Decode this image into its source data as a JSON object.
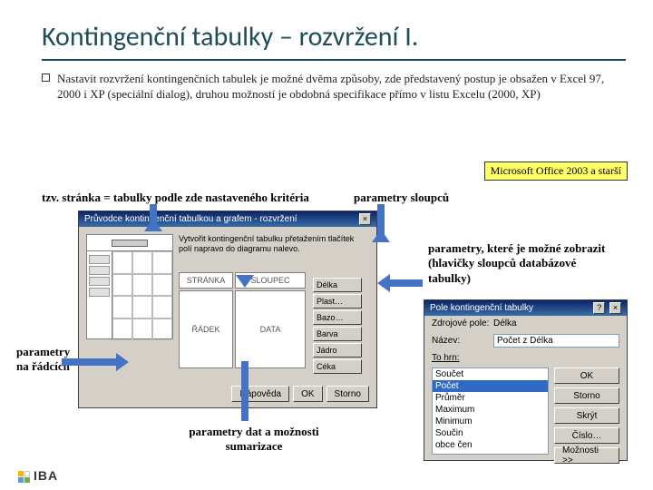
{
  "title": "Kontingenční tabulky – rozvržení I.",
  "bullet": "Nastavit rozvržení kontingenčních tabulek je možné dvěma způsoby, zde představený postup je obsažen v Excel 97, 2000 i XP (speciální dialog), druhou možností je obdobná specifikace přímo v listu Excelu (2000, XP)",
  "badge": "Microsoft Office 2003 a starší",
  "labels": {
    "page": "tzv. stránka = tabulky podle zde nastaveného kritéria",
    "columns": "parametry sloupců",
    "right": "parametry, které je možné zobrazit (hlavičky sloupců databázové tabulky)",
    "rows": "parametry na řádcích",
    "data": "parametry dat a možnosti sumarizace"
  },
  "wizard": {
    "title": "Průvodce kontingenční tabulkou a grafem - rozvržení",
    "close": "×",
    "hint": "Vytvořit kontingenční tabulku přetažením tlačítek polí napravo do diagramu nalevo.",
    "slots": {
      "page": "STRÁNKA",
      "column": "SLOUPEC",
      "row": "ŘÁDEK",
      "data": "DATA"
    },
    "fields": [
      "Délka",
      "Plast…",
      "Bazo…",
      "Barva",
      "Jádro",
      "Céka"
    ],
    "buttons": {
      "help": "Nápověda",
      "ok": "OK",
      "cancel": "Storno"
    }
  },
  "fielddlg": {
    "title": "Pole kontingenční tabulky",
    "help_close": [
      "?",
      "×"
    ],
    "source_label": "Zdrojové pole:",
    "source_value": "Délka",
    "name_label": "Název:",
    "name_value": "Počet z Délka",
    "summary_label": "To hrn:",
    "options": [
      "Součet",
      "Počet",
      "Průměr",
      "Maximum",
      "Minimum",
      "Součin",
      "obce čen"
    ],
    "selected": "Počet",
    "buttons": {
      "ok": "OK",
      "cancel": "Storno",
      "delete": "Skrýt",
      "number": "Číslo…",
      "options": "Možnosti >>"
    }
  },
  "logo": "IBA"
}
